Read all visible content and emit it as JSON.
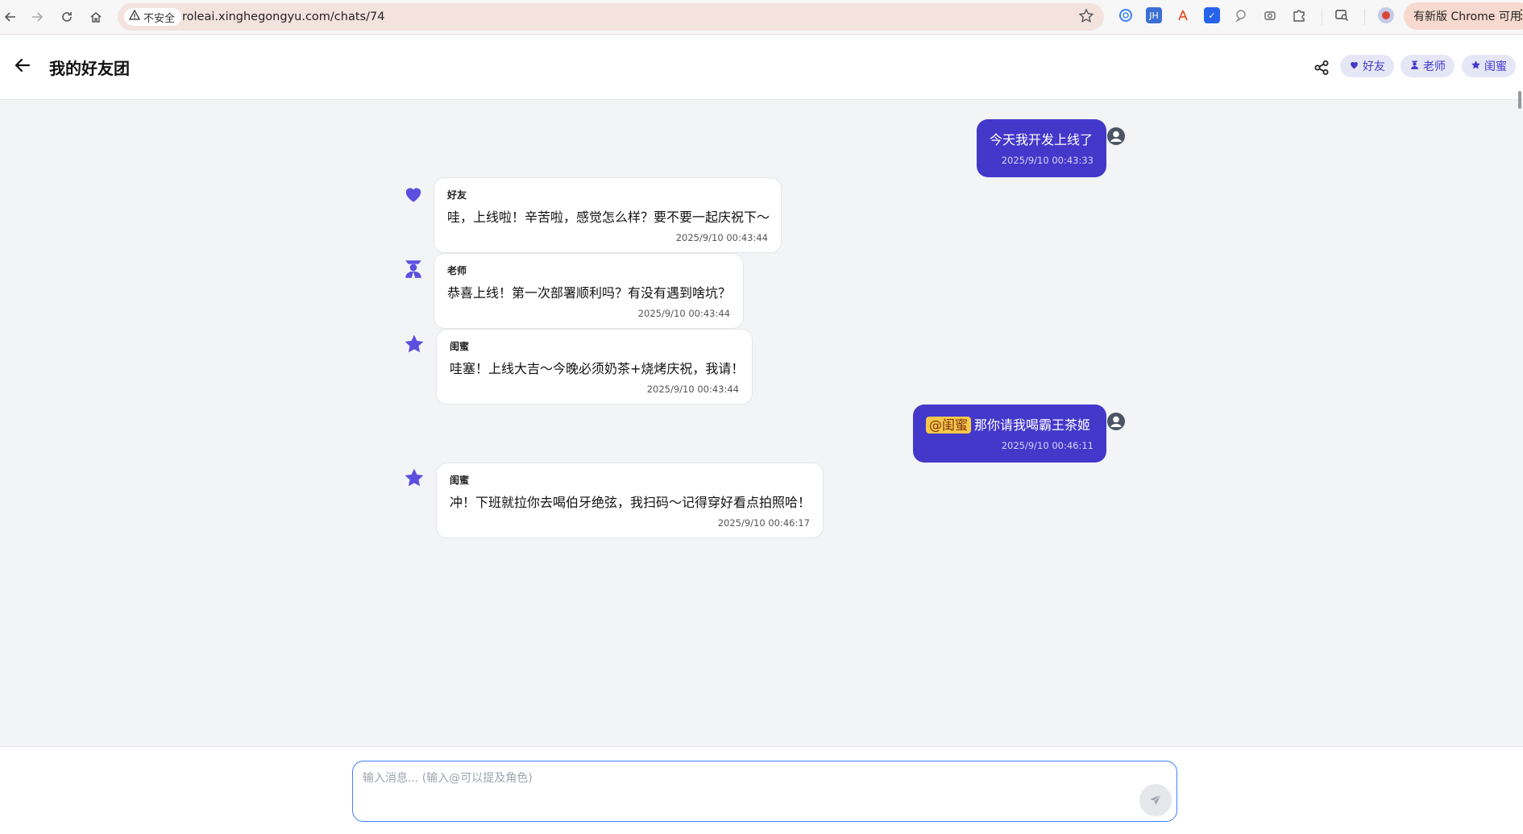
{
  "browser": {
    "security_label": "不安全",
    "url": "roleai.xinghegongyu.com/chats/74",
    "update_label": "有新版 Chrome 可用",
    "extensions": [
      "copilot-icon",
      "jh-extension-icon",
      "translate-extension-icon",
      "blue-extension-icon",
      "chat-extension-icon",
      "camera-icon",
      "puzzle-icon",
      "tab-search-icon",
      "profile-avatar"
    ]
  },
  "header": {
    "title": "我的好友团",
    "roles": [
      {
        "label": "好友",
        "icon": "heart-icon"
      },
      {
        "label": "老师",
        "icon": "teacher-icon"
      },
      {
        "label": "闺蜜",
        "icon": "star-icon"
      }
    ]
  },
  "messages": [
    {
      "role": "user",
      "text": "今天我开发上线了",
      "time": "2025/9/10 00:43:33"
    },
    {
      "role": "bot",
      "sender": "好友",
      "icon": "heart-icon",
      "text": "哇，上线啦！辛苦啦，感觉怎么样？要不要一起庆祝下～",
      "time": "2025/9/10 00:43:44"
    },
    {
      "role": "bot",
      "sender": "老师",
      "icon": "teacher-icon",
      "text": "恭喜上线！第一次部署顺利吗？有没有遇到啥坑？",
      "time": "2025/9/10 00:43:44"
    },
    {
      "role": "bot",
      "sender": "闺蜜",
      "icon": "star-icon",
      "text": "哇塞！上线大吉～今晚必须奶茶+烧烤庆祝，我请！",
      "time": "2025/9/10 00:43:44"
    },
    {
      "role": "user",
      "mention": "@闺蜜",
      "text": "那你请我喝霸王茶姬",
      "time": "2025/9/10 00:46:11"
    },
    {
      "role": "bot",
      "sender": "闺蜜",
      "icon": "star-icon",
      "text": "冲！下班就拉你去喝伯牙绝弦，我扫码～记得穿好看点拍照哈！",
      "time": "2025/9/10 00:46:17"
    }
  ],
  "composer": {
    "placeholder": "输入消息... (输入@可以提及角色)"
  },
  "colors": {
    "accent": "#4338ca",
    "icon": "#5b4fe0",
    "mention_bg": "#f7c948",
    "page_bg": "#f3f4f6"
  }
}
